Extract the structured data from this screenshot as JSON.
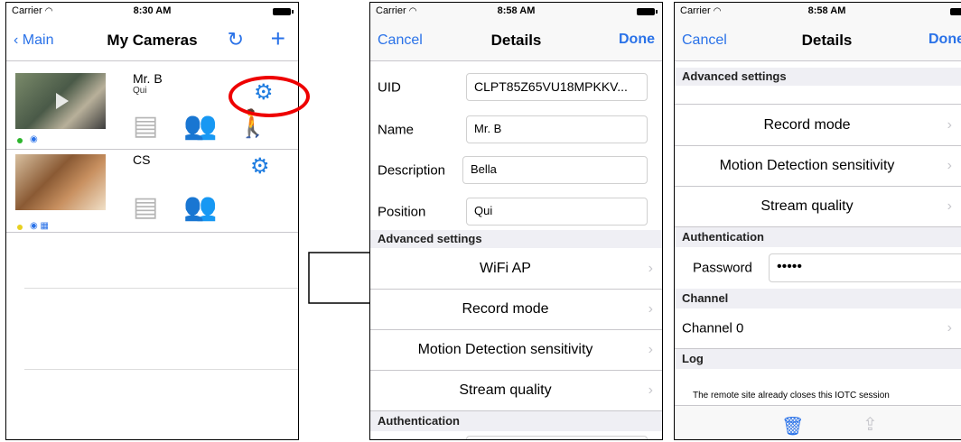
{
  "screen1": {
    "carrier": "Carrier",
    "time": "8:30 AM",
    "back_label": "Main",
    "title": "My Cameras",
    "cameras": [
      {
        "name": "Mr. B",
        "sub": "Qui"
      },
      {
        "name": "CS",
        "sub": ""
      }
    ]
  },
  "screen2": {
    "carrier": "Carrier",
    "time": "8:58 AM",
    "cancel": "Cancel",
    "title": "Details",
    "done": "Done",
    "fields": {
      "uid_label": "UID",
      "uid_value": "CLPT85Z65VU18MPKKV...",
      "name_label": "Name",
      "name_value": "Mr. B",
      "desc_label": "Description",
      "desc_value": "Bella",
      "pos_label": "Position",
      "pos_value": "Qui"
    },
    "advanced_header": "Advanced settings",
    "advanced_items": [
      "WiFi AP",
      "Record mode",
      "Motion Detection sensitivity",
      "Stream quality"
    ],
    "auth_header": "Authentication"
  },
  "screen3": {
    "carrier": "Carrier",
    "time": "8:58 AM",
    "cancel": "Cancel",
    "title": "Details",
    "done": "Done",
    "advanced_header": "Advanced settings",
    "advanced_items": [
      "Record mode",
      "Motion Detection sensitivity",
      "Stream quality"
    ],
    "auth_header": "Authentication",
    "password_label": "Password",
    "password_value": "•••••",
    "channel_header": "Channel",
    "channel_value": "Channel 0",
    "log_header": "Log",
    "log_text": "The remote site already closes this IOTC session"
  },
  "colors": {
    "accent": "#2a72e8",
    "highlight": "#ee0000",
    "gear": "#1e7ce0"
  },
  "icons": [
    "back-chevron-icon",
    "refresh-icon",
    "plus-icon",
    "gear-icon",
    "film-icon",
    "users-icon",
    "motion-icon",
    "chevron-right-icon",
    "trash-icon",
    "share-icon",
    "wifi-icon",
    "battery-icon"
  ]
}
